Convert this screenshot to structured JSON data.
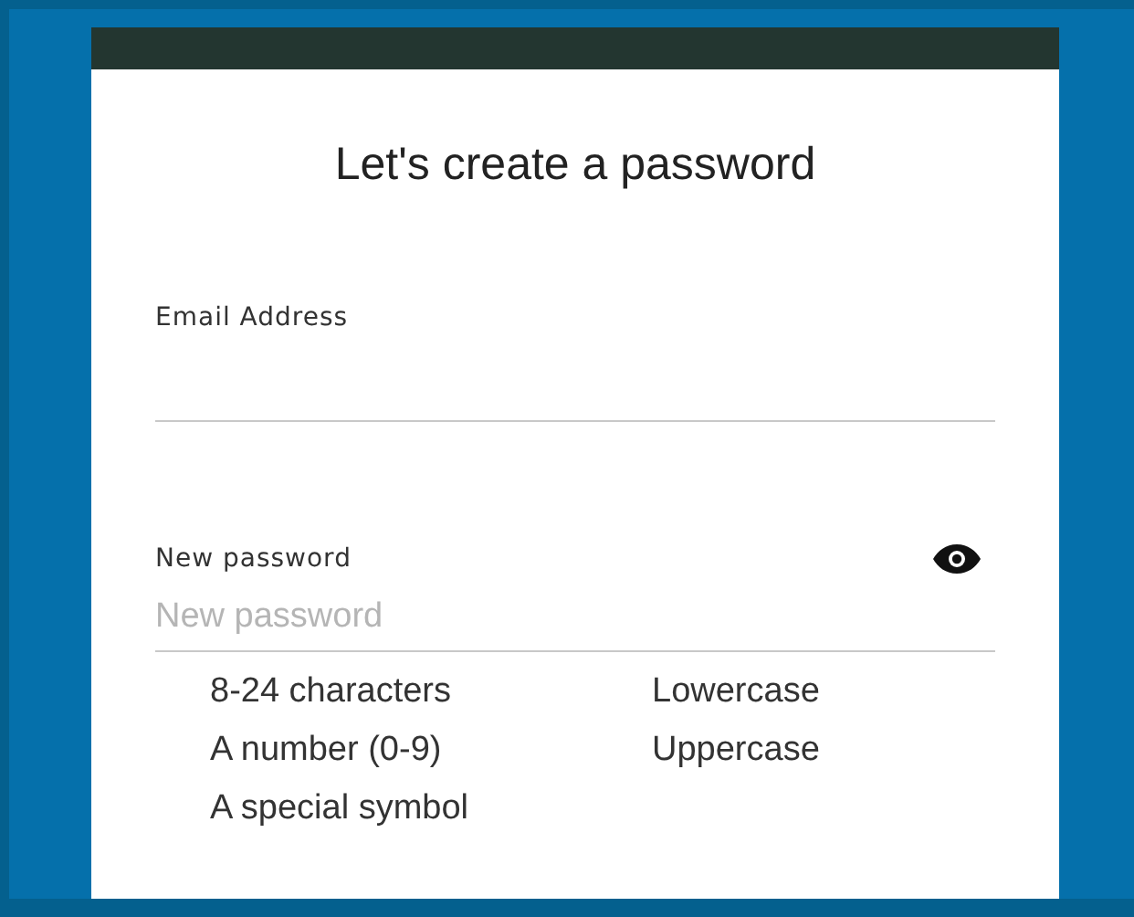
{
  "title": "Let's create a password",
  "email_field": {
    "label": "Email Address"
  },
  "password_field": {
    "label": "New password",
    "placeholder": "New password"
  },
  "requirements": [
    "8-24 characters",
    "Lowercase",
    "A number (0-9)",
    "Uppercase",
    "A special symbol"
  ]
}
